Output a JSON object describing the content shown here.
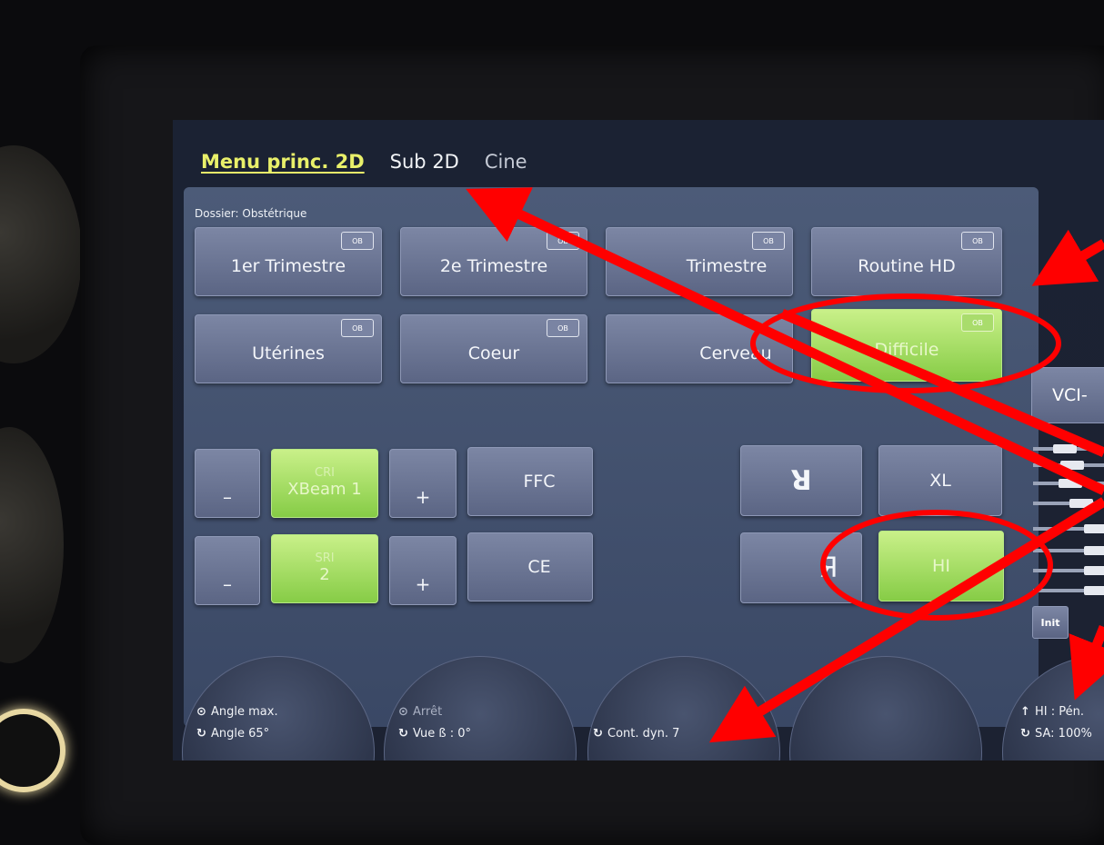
{
  "tabs": [
    "Menu princ. 2D",
    "Sub 2D",
    "Cine"
  ],
  "folder": "Dossier: Obstétrique",
  "presets": [
    {
      "label": "1er Trimestre",
      "badge": "OB"
    },
    {
      "label": "2e Trimestre",
      "badge": "OB"
    },
    {
      "label": "Trimestre",
      "badge": "OB"
    },
    {
      "label": "Routine HD",
      "badge": "OB"
    },
    {
      "label": "Utérines",
      "badge": "OB"
    },
    {
      "label": "Coeur",
      "badge": "OB"
    },
    {
      "label": "Cerveau",
      "badge": ""
    },
    {
      "label": "Difficile",
      "badge": "OB"
    }
  ],
  "controls": {
    "minus": "–",
    "plus": "+",
    "xbeam_line1": "CRI",
    "xbeam_line2": "XBeam 1",
    "sri_line1": "SRI",
    "sri_line2": "2",
    "ffc": "FFC",
    "ce": "CE",
    "flip_up": "ꓤ",
    "flip_lr": "Я",
    "xl": "XL",
    "hi": "HI"
  },
  "side": {
    "button": "VCI-",
    "init": "Init"
  },
  "dials": [
    {
      "line1": "Angle max.",
      "line2": "Angle 65°",
      "icon1": "circle-dot-icon",
      "icon2": "rotate-icon"
    },
    {
      "line1": "Arrêt",
      "line2": "Vue ß :  0°",
      "icon1": "circle-dot-icon",
      "icon2": "rotate-icon"
    },
    {
      "line1": "",
      "line2": "Cont. dyn. 7",
      "icon2": "rotate-icon"
    },
    {
      "line1": "",
      "line2": ""
    },
    {
      "line1": "HI : Pén.",
      "line2": "SA: 100%",
      "icon1": "up-arrow-icon",
      "icon2": "rotate-icon"
    }
  ],
  "colors": {
    "accent_tab": "#e9f06a",
    "active_green": "#86cc46",
    "annotation_red": "#ff0000"
  }
}
